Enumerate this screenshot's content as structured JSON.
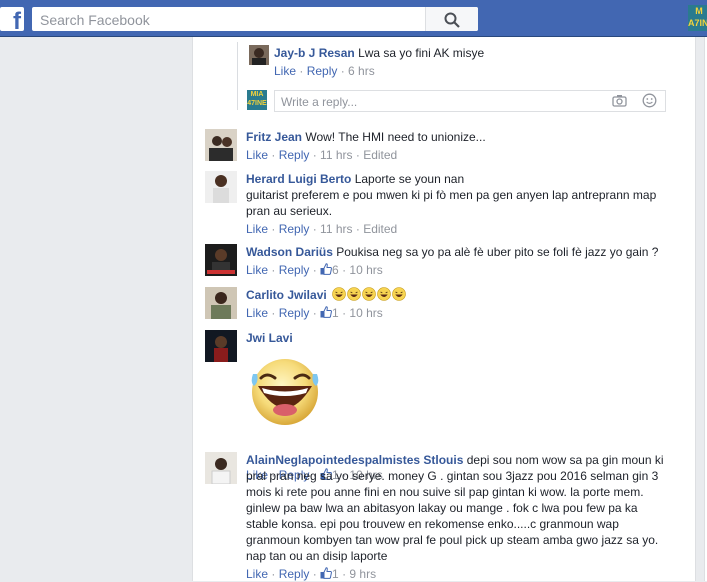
{
  "header": {
    "logo_letter": "f",
    "search_placeholder": "Search Facebook",
    "profile_badge": "M\nA7INE",
    "colors": {
      "bar": "#4267b2",
      "link": "#365899"
    }
  },
  "reply_thread": {
    "comment": {
      "author": "Jay-b J Resan",
      "text": "Lwa sa yo fini AK misye",
      "like": "Like",
      "reply": "Reply",
      "time": "6 hrs"
    },
    "reply_box": {
      "placeholder": "Write a reply...",
      "avatar_text": "MIA\n47INE"
    }
  },
  "comments": [
    {
      "author": "Fritz Jean",
      "text": "Wow! The HMI need to unionize...",
      "like": "Like",
      "reply": "Reply",
      "time": "11 hrs",
      "edited": "Edited"
    },
    {
      "author": "Herard Luigi Berto",
      "text": "Laporte se youn nan",
      "text2": "guitarist preferem e pou mwen ki pi fò men pa gen anyen lap antreprann map",
      "text3": "pran au serieux.",
      "like": "Like",
      "reply": "Reply",
      "time": "11 hrs",
      "edited": "Edited"
    },
    {
      "author": "Wadson Dariüs",
      "text": "Poukisa neg sa yo pa alè fè uber pito se foli fè jazz yo gain ?",
      "like": "Like",
      "reply": "Reply",
      "likes": "6",
      "time": "10 hrs"
    },
    {
      "author": "Carlito Jwilavi",
      "text": "",
      "laugh_emojis": 5,
      "like": "Like",
      "reply": "Reply",
      "likes": "1",
      "time": "10 hrs"
    },
    {
      "author": "Jwi Lavi",
      "sticker": "laughing-face-sticker",
      "like": "Like",
      "reply": "Reply",
      "likes": "1",
      "time": "10 hrs"
    },
    {
      "author": "AlainNeglapointedespalmistes Stlouis",
      "text": "depi sou nom wow sa pa gin moun ki",
      "lines": [
        "pral pran neg sa yo serye. money G . gintan sou 3jazz pou 2016 selman gin 3",
        "mois ki rete pou anne fini en nou suive sil pap gintan ki wow. la porte mem.",
        "ginlew pa baw lwa an abitasyon lakay ou mange . fok c lwa pou few pa ka",
        "stable konsa. epi pou trouvew en rekomense enko.....c granmoun wap",
        "granmoun kombyen tan wow pral fe poul pick up steam amba gwo jazz sa yo.",
        "nap tan ou an disip laporte"
      ],
      "like": "Like",
      "reply": "Reply",
      "likes": "1",
      "time": "9 hrs"
    }
  ]
}
